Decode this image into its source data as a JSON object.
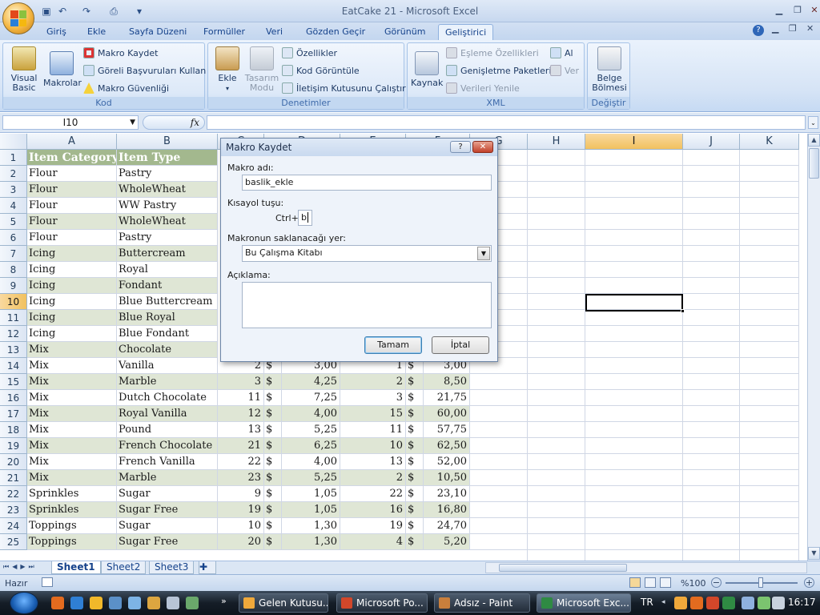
{
  "window": {
    "title": "EatCake 21 - Microsoft Excel"
  },
  "ribbon": {
    "tabs": [
      "Giriş",
      "Ekle",
      "Sayfa Düzeni",
      "Formüller",
      "Veri",
      "Gözden Geçir",
      "Görünüm",
      "Geliştirici"
    ],
    "active_tab": "Geliştirici",
    "groups": {
      "kod": {
        "label": "Kod",
        "visual_basic": "Visual Basic",
        "makrolar": "Makrolar",
        "makro_kaydet": "Makro Kaydet",
        "goreli": "Göreli Başvuruları Kullan",
        "guvenlik": "Makro Güvenliği"
      },
      "denetimler": {
        "label": "Denetimler",
        "ekle": "Ekle",
        "tasarim_modu": "Tasarım Modu",
        "ozellikler": "Özellikler",
        "kod_goruntule": "Kod Görüntüle",
        "iletisim": "İletişim Kutusunu Çalıştır"
      },
      "xml": {
        "label": "XML",
        "kaynak": "Kaynak",
        "esleme": "Eşleme Özellikleri",
        "genisletme": "Genişletme Paketleri",
        "verileri_yenile": "Verileri Yenile",
        "al": "Al",
        "ver": "Ver"
      },
      "degistir": {
        "label": "Değiştir",
        "belge_bolmesi": "Belge Bölmesi"
      }
    }
  },
  "formula_bar": {
    "name_box": "I10",
    "fx": "fx",
    "formula": ""
  },
  "columns": [
    "A",
    "B",
    "C",
    "D",
    "E",
    "F",
    "G",
    "H",
    "I",
    "J",
    "K"
  ],
  "selected_column": "I",
  "selected_row": "10",
  "header_row": {
    "a": "Item Category",
    "b": "Item Type"
  },
  "rows": [
    {
      "n": "2",
      "a": "Flour",
      "b": "Pastry"
    },
    {
      "n": "3",
      "a": "Flour",
      "b": "WholeWheat"
    },
    {
      "n": "4",
      "a": "Flour",
      "b": "WW Pastry"
    },
    {
      "n": "5",
      "a": "Flour",
      "b": "WholeWheat"
    },
    {
      "n": "6",
      "a": "Flour",
      "b": "Pastry"
    },
    {
      "n": "7",
      "a": "Icing",
      "b": "Buttercream"
    },
    {
      "n": "8",
      "a": "Icing",
      "b": "Royal"
    },
    {
      "n": "9",
      "a": "Icing",
      "b": "Fondant"
    },
    {
      "n": "10",
      "a": "Icing",
      "b": "Blue Buttercream"
    },
    {
      "n": "11",
      "a": "Icing",
      "b": "Blue Royal"
    },
    {
      "n": "12",
      "a": "Icing",
      "b": "Blue Fondant"
    },
    {
      "n": "13",
      "a": "Mix",
      "b": "Chocolate"
    },
    {
      "n": "14",
      "a": "Mix",
      "b": "Vanilla",
      "c": "2",
      "d": "$",
      "e": "3,00",
      "f": "1",
      "g": "$",
      "h": "3,00"
    },
    {
      "n": "15",
      "a": "Mix",
      "b": "Marble",
      "c": "3",
      "d": "$",
      "e": "4,25",
      "f": "2",
      "g": "$",
      "h": "8,50"
    },
    {
      "n": "16",
      "a": "Mix",
      "b": "Dutch Chocolate",
      "c": "11",
      "d": "$",
      "e": "7,25",
      "f": "3",
      "g": "$",
      "h": "21,75"
    },
    {
      "n": "17",
      "a": "Mix",
      "b": "Royal Vanilla",
      "c": "12",
      "d": "$",
      "e": "4,00",
      "f": "15",
      "g": "$",
      "h": "60,00"
    },
    {
      "n": "18",
      "a": "Mix",
      "b": "Pound",
      "c": "13",
      "d": "$",
      "e": "5,25",
      "f": "11",
      "g": "$",
      "h": "57,75"
    },
    {
      "n": "19",
      "a": "Mix",
      "b": "French Chocolate",
      "c": "21",
      "d": "$",
      "e": "6,25",
      "f": "10",
      "g": "$",
      "h": "62,50"
    },
    {
      "n": "20",
      "a": "Mix",
      "b": "French Vanilla",
      "c": "22",
      "d": "$",
      "e": "4,00",
      "f": "13",
      "g": "$",
      "h": "52,00"
    },
    {
      "n": "21",
      "a": "Mix",
      "b": "Marble",
      "c": "23",
      "d": "$",
      "e": "5,25",
      "f": "2",
      "g": "$",
      "h": "10,50"
    },
    {
      "n": "22",
      "a": "Sprinkles",
      "b": "Sugar",
      "c": "9",
      "d": "$",
      "e": "1,05",
      "f": "22",
      "g": "$",
      "h": "23,10"
    },
    {
      "n": "23",
      "a": "Sprinkles",
      "b": "Sugar Free",
      "c": "19",
      "d": "$",
      "e": "1,05",
      "f": "16",
      "g": "$",
      "h": "16,80"
    },
    {
      "n": "24",
      "a": "Toppings",
      "b": "Sugar",
      "c": "10",
      "d": "$",
      "e": "1,30",
      "f": "19",
      "g": "$",
      "h": "24,70"
    },
    {
      "n": "25",
      "a": "Toppings",
      "b": "Sugar Free",
      "c": "20",
      "d": "$",
      "e": "1,30",
      "f": "4",
      "g": "$",
      "h": "5,20"
    }
  ],
  "sheets": [
    "Sheet1",
    "Sheet2",
    "Sheet3"
  ],
  "active_sheet": "Sheet1",
  "status": {
    "ready": "Hazır",
    "zoom": "%100"
  },
  "dialog": {
    "title": "Makro Kaydet",
    "help": "?",
    "macro_name_label": "Makro adı:",
    "macro_name": "baslik_ekle",
    "shortcut_label": "Kısayol tuşu:",
    "ctrl": "Ctrl+",
    "shortcut_key": "b",
    "store_label": "Makronun saklanacağı yer:",
    "store_value": "Bu Çalışma Kitabı",
    "desc_label": "Açıklama:",
    "ok": "Tamam",
    "cancel": "İptal"
  },
  "taskbar": {
    "items": [
      {
        "label": "Gelen Kutusu...",
        "active": false
      },
      {
        "label": "Microsoft Po...",
        "active": false
      },
      {
        "label": "Adsız - Paint",
        "active": false
      },
      {
        "label": "Microsoft Exc...",
        "active": true
      }
    ],
    "lang": "TR",
    "clock": "16:17"
  },
  "colors": {
    "header_fill": "#a3b88e",
    "band_fill": "#dfe6d5",
    "selection": "#f1c15f"
  }
}
